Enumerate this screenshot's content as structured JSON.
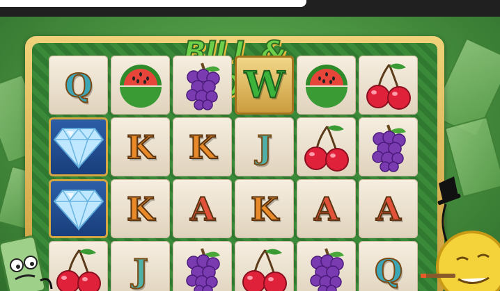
{
  "game": {
    "title": "BILL & COIN"
  },
  "colors": {
    "background": "#4f9a45",
    "frame_gold": "#e2b95a",
    "tile": "#efe5d2"
  },
  "reels": {
    "rows": [
      [
        "Q",
        "watermelon",
        "grapes",
        "W",
        "watermelon",
        "cherry"
      ],
      [
        "diamond",
        "K",
        "K",
        "J",
        "cherry",
        "grapes"
      ],
      [
        "diamond",
        "K",
        "A",
        "K",
        "A",
        "A"
      ],
      [
        "cherry",
        "J",
        "grapes",
        "cherry",
        "grapes",
        "Q"
      ]
    ]
  },
  "characters": {
    "left": "bill-character",
    "right": "coin-character"
  }
}
